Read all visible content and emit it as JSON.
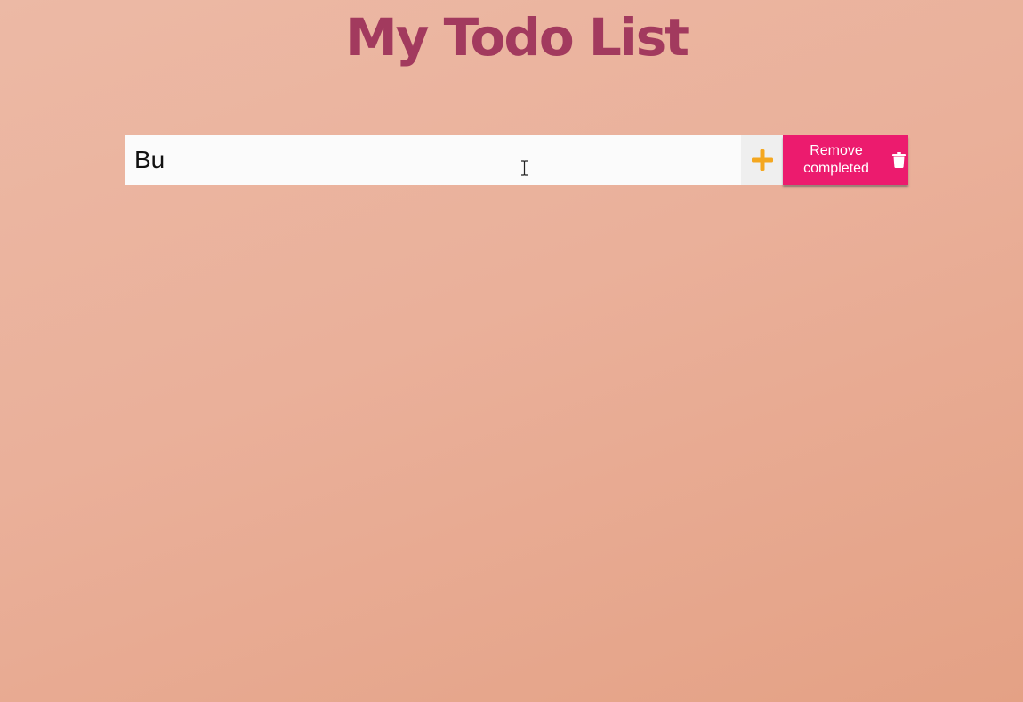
{
  "app": {
    "title": "My Todo List"
  },
  "todo_form": {
    "input_value": "Bu",
    "add_icon": "plus-icon",
    "remove_completed_label": "Remove\ncompleted",
    "remove_icon": "trash-icon"
  },
  "colors": {
    "title": "#a23a5e",
    "add_icon": "#f4a71f",
    "remove_button": "#ec1b6e",
    "input_background": "#fbfbfb"
  },
  "cursor": {
    "icon": "text-cursor-icon"
  }
}
